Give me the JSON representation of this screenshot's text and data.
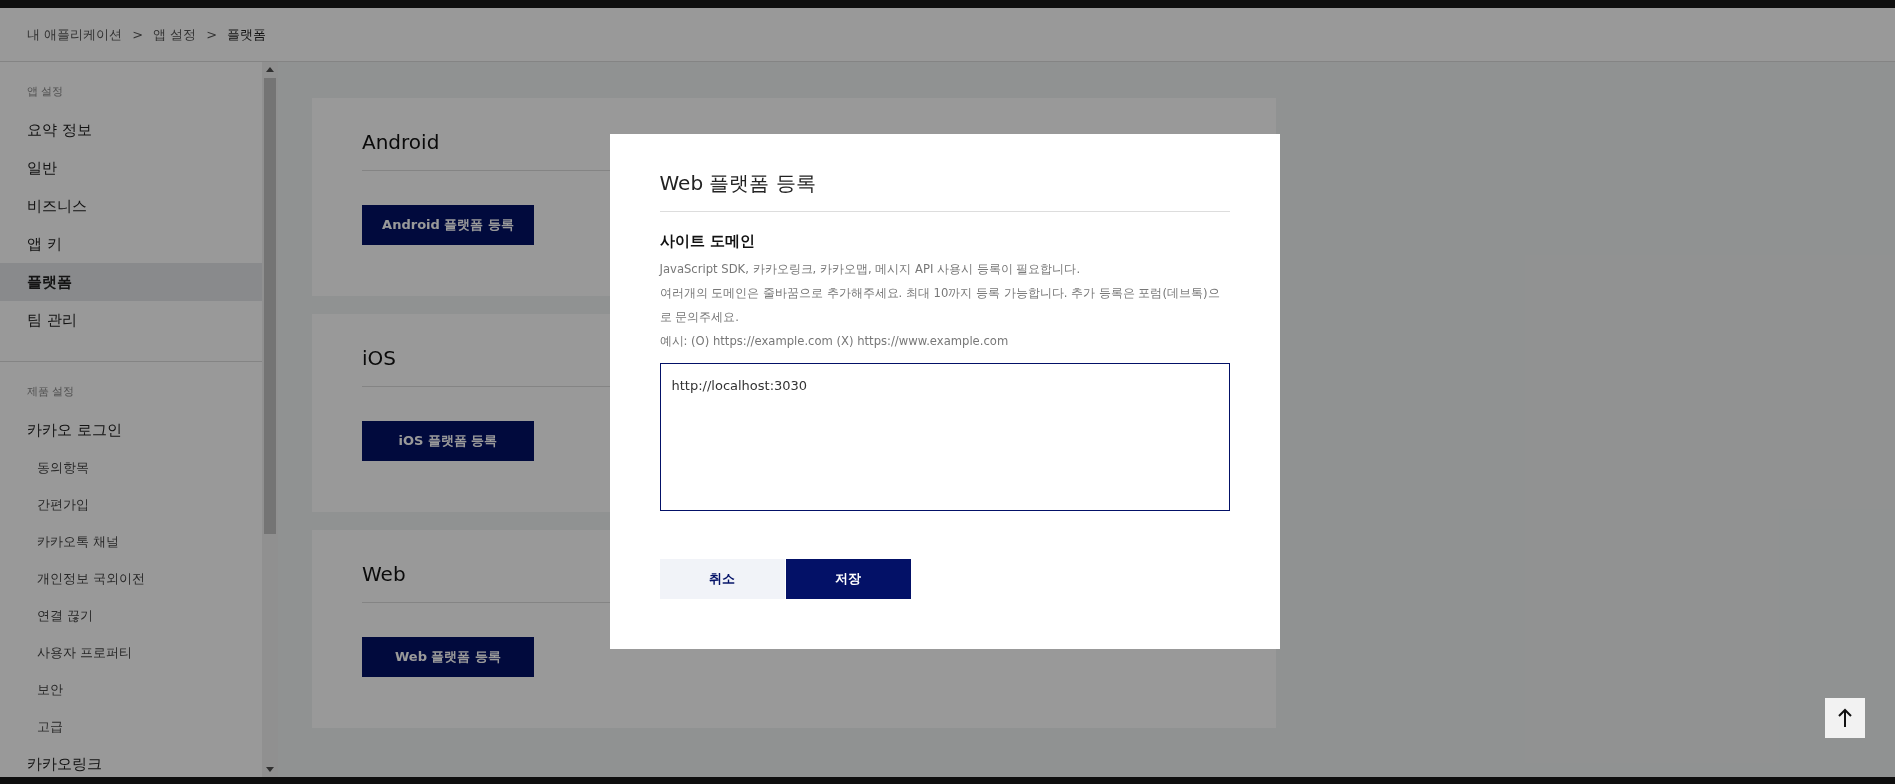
{
  "breadcrumb_separator": ">",
  "breadcrumb": [
    {
      "label": "내 애플리케이션",
      "current": false
    },
    {
      "label": "앱 설정",
      "current": false
    },
    {
      "label": "플랫폼",
      "current": true
    }
  ],
  "sidebar": {
    "sections": [
      {
        "heading": "앱 설정",
        "items": [
          {
            "label": "요약 정보",
            "selected": false
          },
          {
            "label": "일반",
            "selected": false
          },
          {
            "label": "비즈니스",
            "selected": false
          },
          {
            "label": "앱 키",
            "selected": false
          },
          {
            "label": "플랫폼",
            "selected": true
          },
          {
            "label": "팀 관리",
            "selected": false
          }
        ]
      },
      {
        "heading": "제품 설정",
        "items": [
          {
            "label": "카카오 로그인",
            "selected": false,
            "children": [
              {
                "label": "동의항목",
                "selected": false
              },
              {
                "label": "간편가입",
                "selected": false
              },
              {
                "label": "카카오톡 채널",
                "selected": false
              },
              {
                "label": "개인정보 국외이전",
                "selected": false
              },
              {
                "label": "연결 끊기",
                "selected": false
              },
              {
                "label": "사용자 프로퍼티",
                "selected": false
              },
              {
                "label": "보안",
                "selected": false
              },
              {
                "label": "고급",
                "selected": false
              }
            ]
          },
          {
            "label": "카카오링크",
            "selected": false
          }
        ]
      }
    ]
  },
  "platforms": [
    {
      "title": "Android",
      "button": "Android 플랫폼 등록"
    },
    {
      "title": "iOS",
      "button": "iOS 플랫폼 등록"
    },
    {
      "title": "Web",
      "button": "Web 플랫폼 등록"
    }
  ],
  "dialog": {
    "title": "Web 플랫폼 등록",
    "field_label": "사이트 도메인",
    "description": [
      "JavaScript SDK, 카카오링크, 카카오맵, 메시지 API 사용시 등록이 필요합니다.",
      "여러개의 도메인은 줄바꿈으로 추가해주세요. 최대 10까지 등록 가능합니다. 추가 등록은 포럼(데브톡)으로 문의주세요.",
      "예시: (O) https://example.com (X) https://www.example.com"
    ],
    "value": "http://localhost:3030",
    "buttons": [
      {
        "label": "취소",
        "kind": "secondary"
      },
      {
        "label": "저장",
        "kind": "primary"
      }
    ]
  }
}
